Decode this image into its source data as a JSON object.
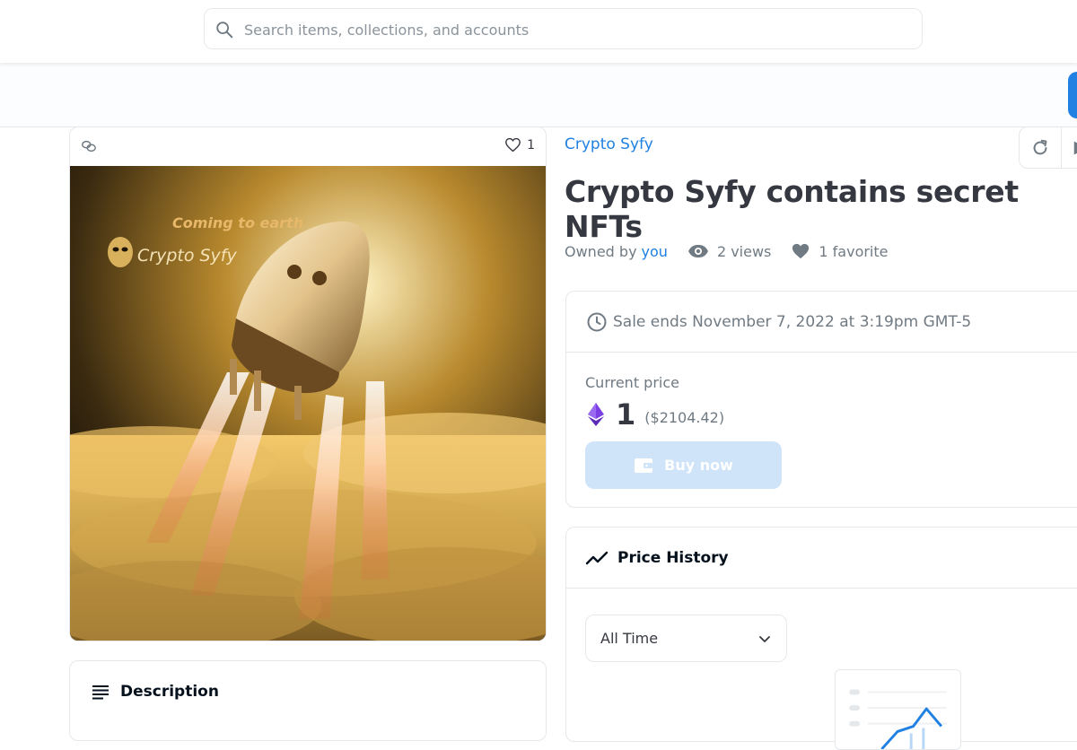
{
  "search": {
    "placeholder": "Search items, collections, and accounts"
  },
  "asset": {
    "favorite_count": "1",
    "art_caption": "Coming to earth",
    "art_brand": "Crypto Syfy"
  },
  "description": {
    "title": "Description"
  },
  "collection": {
    "name": "Crypto Syfy"
  },
  "item": {
    "title": "Crypto Syfy contains secret NFTs",
    "owned_by_label": "Owned by",
    "owner": "you",
    "views": "2 views",
    "favorites": "1 favorite"
  },
  "sale": {
    "ends_text": "Sale ends November 7, 2022 at 3:19pm GMT-5",
    "current_price_label": "Current price",
    "price": "1",
    "price_usd": "($2104.42)",
    "buy_label": "Buy now"
  },
  "price_history": {
    "title": "Price History",
    "range": "All Time"
  },
  "colors": {
    "accent": "#2081e2",
    "buy_button_disabled": "#cfe3f9",
    "eth": "#7b3fe4"
  }
}
